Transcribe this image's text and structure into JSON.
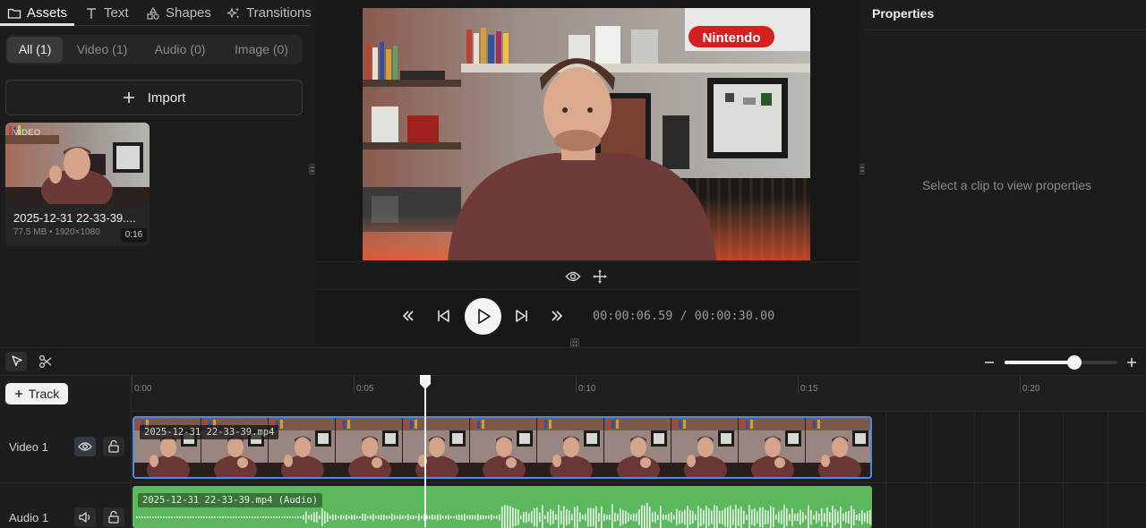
{
  "left_panel": {
    "tabs": [
      {
        "label": "Assets",
        "icon": "folder-icon",
        "active": true
      },
      {
        "label": "Text",
        "icon": "text-icon",
        "active": false
      },
      {
        "label": "Shapes",
        "icon": "shapes-icon",
        "active": false
      },
      {
        "label": "Transitions",
        "icon": "sparkles-icon",
        "active": false
      }
    ],
    "filters": [
      {
        "label": "All (1)",
        "active": true
      },
      {
        "label": "Video (1)",
        "active": false
      },
      {
        "label": "Audio (0)",
        "active": false
      },
      {
        "label": "Image (0)",
        "active": false
      }
    ],
    "import_label": "Import",
    "asset": {
      "type_badge": "VIDEO",
      "name": "2025-12-31 22-33-39....",
      "meta": "77.5 MB • 1920×1080",
      "duration": "0:16"
    }
  },
  "preview": {
    "timecode_current": "00:00:06.59",
    "timecode_sep": " / ",
    "timecode_total": "00:00:30.00"
  },
  "properties": {
    "title": "Properties",
    "empty_message": "Select a clip to view properties"
  },
  "timeline": {
    "add_track_label": "Track",
    "zoom_level": 0.62,
    "ruler_ticks": [
      "0:00",
      "0:05",
      "0:10",
      "0:15",
      "0:20"
    ],
    "tracks": [
      {
        "name": "Video 1",
        "clip_label": "2025-12-31 22-33-39.mp4"
      },
      {
        "name": "Audio 1",
        "clip_label": "2025-12-31 22-33-39.mp4 (Audio)"
      }
    ]
  },
  "colors": {
    "accent_clip_border": "#4a8de0",
    "audio_clip": "#5cb85c"
  }
}
